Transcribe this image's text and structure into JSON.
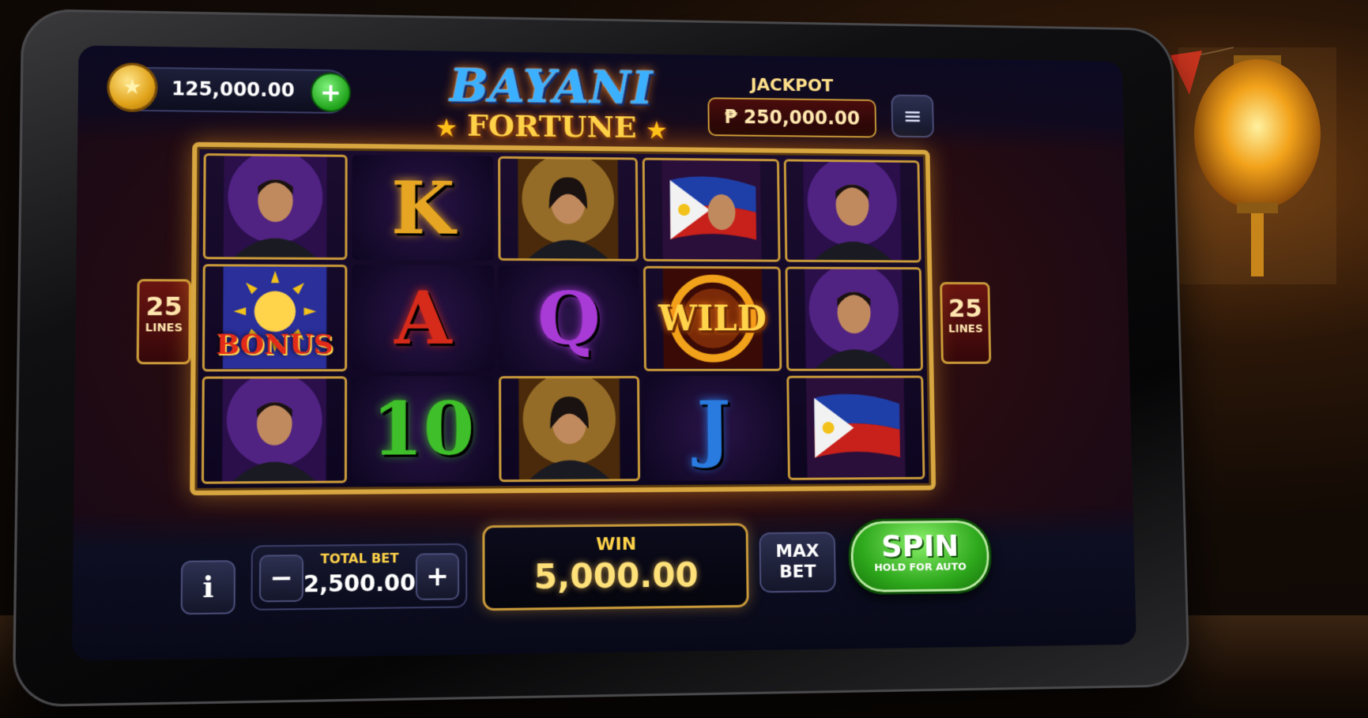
{
  "balance": {
    "value": "125,000.00",
    "add_label": "+"
  },
  "logo": {
    "line1": "BAYANI",
    "line2": "FORTUNE"
  },
  "jackpot": {
    "label": "JACKPOT",
    "value": "₱ 250,000.00"
  },
  "menu": {
    "icon": "≡"
  },
  "lines": {
    "count": "25",
    "label": "LINES"
  },
  "reels": [
    [
      {
        "symbol": "hero-portrait",
        "text": ""
      },
      {
        "symbol": "bonus",
        "text": "BONUS"
      },
      {
        "symbol": "hero-portrait",
        "text": ""
      }
    ],
    [
      {
        "symbol": "letter",
        "text": "K",
        "color": "#e6a623"
      },
      {
        "symbol": "letter",
        "text": "A",
        "color": "#d62a1a"
      },
      {
        "symbol": "letter",
        "text": "10",
        "color": "#3fbf2a"
      }
    ],
    [
      {
        "symbol": "heroine-portrait",
        "text": ""
      },
      {
        "symbol": "letter",
        "text": "Q",
        "color": "#a83ad6"
      },
      {
        "symbol": "heroine-portrait",
        "text": ""
      }
    ],
    [
      {
        "symbol": "flag-hero",
        "text": ""
      },
      {
        "symbol": "wild",
        "text": "WILD"
      },
      {
        "symbol": "letter",
        "text": "J",
        "color": "#2a7be0"
      }
    ],
    [
      {
        "symbol": "hero-portrait",
        "text": ""
      },
      {
        "symbol": "hero-portrait",
        "text": ""
      },
      {
        "symbol": "flag",
        "text": ""
      }
    ]
  ],
  "controls": {
    "info_label": "i",
    "total_bet_label": "TOTAL BET",
    "total_bet_value": "2,500.00",
    "minus_label": "−",
    "plus_label": "+",
    "win_label": "WIN",
    "win_value": "5,000.00",
    "max_bet_line1": "MAX",
    "max_bet_line2": "BET",
    "spin_label": "SPIN",
    "spin_sub": "HOLD FOR AUTO"
  }
}
